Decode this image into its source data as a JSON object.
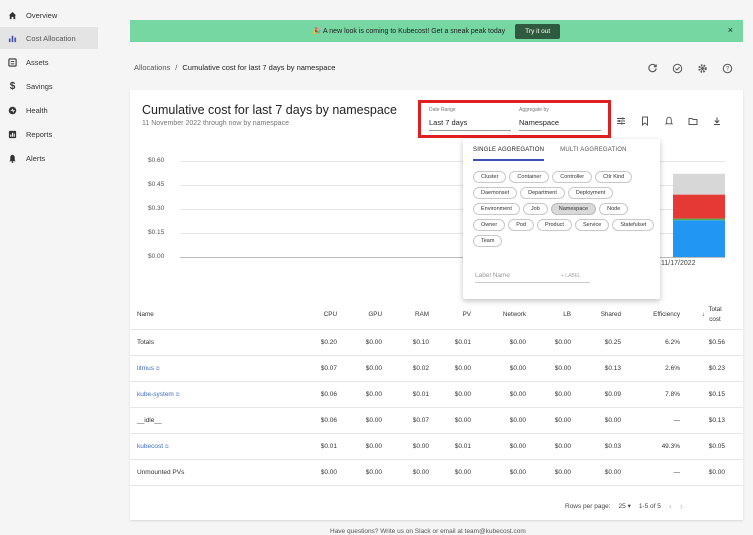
{
  "sidebar": {
    "items": [
      {
        "label": "Overview",
        "icon": "home-icon"
      },
      {
        "label": "Cost Allocation",
        "icon": "bar-chart-icon"
      },
      {
        "label": "Assets",
        "icon": "list-icon"
      },
      {
        "label": "Savings",
        "icon": "dollar-icon"
      },
      {
        "label": "Health",
        "icon": "heart-icon"
      },
      {
        "label": "Reports",
        "icon": "report-icon"
      },
      {
        "label": "Alerts",
        "icon": "bell-icon"
      }
    ]
  },
  "banner": {
    "text": "🎉 A new look is coming to Kubecost! Get a sneak peak today",
    "button": "Try it out",
    "close": "×"
  },
  "breadcrumb": {
    "root": "Allocations",
    "sep": "/",
    "current": "Cumulative cost for last 7 days by namespace"
  },
  "report": {
    "title": "Cumulative cost for last 7 days by namespace",
    "subtitle": "11 November 2022 through now by namespace"
  },
  "controls": {
    "date_range_label": "Date Range",
    "date_range_value": "Last 7 days",
    "aggregate_label": "Aggregate by",
    "aggregate_value": "Namespace"
  },
  "chart": {
    "y_ticks": [
      "$0.60",
      "$0.45",
      "$0.30",
      "$0.15",
      "$0.00"
    ],
    "x_label": "11/17/2022"
  },
  "chart_data": {
    "type": "bar",
    "categories": [
      "11/17/2022"
    ],
    "series": [
      {
        "values": [
          0.23
        ],
        "color": "#2196f3"
      },
      {
        "values": [
          0.01
        ],
        "color": "#4caf50"
      },
      {
        "values": [
          0.15
        ],
        "color": "#e53935"
      },
      {
        "values": [
          0.13
        ],
        "color": "#d7d7d7"
      }
    ],
    "ylim": [
      0,
      0.6
    ]
  },
  "popover": {
    "tab_single": "SINGLE AGGREGATION",
    "tab_multi": "MULTI AGGREGATION",
    "chips": [
      "Cluster",
      "Container",
      "Controller",
      "Ctlr Kind",
      "Daemonset",
      "Department",
      "Deployment",
      "Environment",
      "Job",
      "Namespace",
      "Node",
      "Owner",
      "Pod",
      "Product",
      "Service",
      "Statefulset",
      "Team"
    ],
    "selected_chip": "Namespace",
    "label_placeholder": "Label Name",
    "label_add": "+ LABEL"
  },
  "table": {
    "headers": [
      "Name",
      "CPU",
      "GPU",
      "RAM",
      "PV",
      "Network",
      "LB",
      "Shared",
      "Efficiency",
      "↓",
      "Total cost"
    ],
    "rows": [
      {
        "name": "Totals",
        "link": false,
        "cpu": "$0.20",
        "gpu": "$0.00",
        "ram": "$0.10",
        "pv": "$0.01",
        "network": "$0.00",
        "lb": "$0.00",
        "shared": "$0.25",
        "efficiency": "6.2%",
        "total": "$0.56"
      },
      {
        "name": "litmus",
        "link": true,
        "cpu": "$0.07",
        "gpu": "$0.00",
        "ram": "$0.02",
        "pv": "$0.00",
        "network": "$0.00",
        "lb": "$0.00",
        "shared": "$0.13",
        "efficiency": "2.6%",
        "total": "$0.23"
      },
      {
        "name": "kube-system",
        "link": true,
        "cpu": "$0.06",
        "gpu": "$0.00",
        "ram": "$0.01",
        "pv": "$0.00",
        "network": "$0.00",
        "lb": "$0.00",
        "shared": "$0.09",
        "efficiency": "7.8%",
        "total": "$0.15"
      },
      {
        "name": "__idle__",
        "link": false,
        "cpu": "$0.06",
        "gpu": "$0.00",
        "ram": "$0.07",
        "pv": "$0.00",
        "network": "$0.00",
        "lb": "$0.00",
        "shared": "$0.00",
        "efficiency": "—",
        "total": "$0.13"
      },
      {
        "name": "kubecost",
        "link": true,
        "cpu": "$0.01",
        "gpu": "$0.00",
        "ram": "$0.00",
        "pv": "$0.01",
        "network": "$0.00",
        "lb": "$0.00",
        "shared": "$0.03",
        "efficiency": "49.3%",
        "total": "$0.05"
      },
      {
        "name": "Unmounted PVs",
        "link": false,
        "cpu": "$0.00",
        "gpu": "$0.00",
        "ram": "$0.00",
        "pv": "$0.00",
        "network": "$0.00",
        "lb": "$0.00",
        "shared": "$0.00",
        "efficiency": "—",
        "total": "$0.00"
      }
    ]
  },
  "pagination": {
    "rows_per_page_label": "Rows per page:",
    "rows_per_page": "25",
    "range": "1-5 of 5",
    "prev": "‹",
    "next": "›"
  },
  "footer": {
    "text": "Have questions? Write us on Slack or email at team@kubecost.com"
  }
}
